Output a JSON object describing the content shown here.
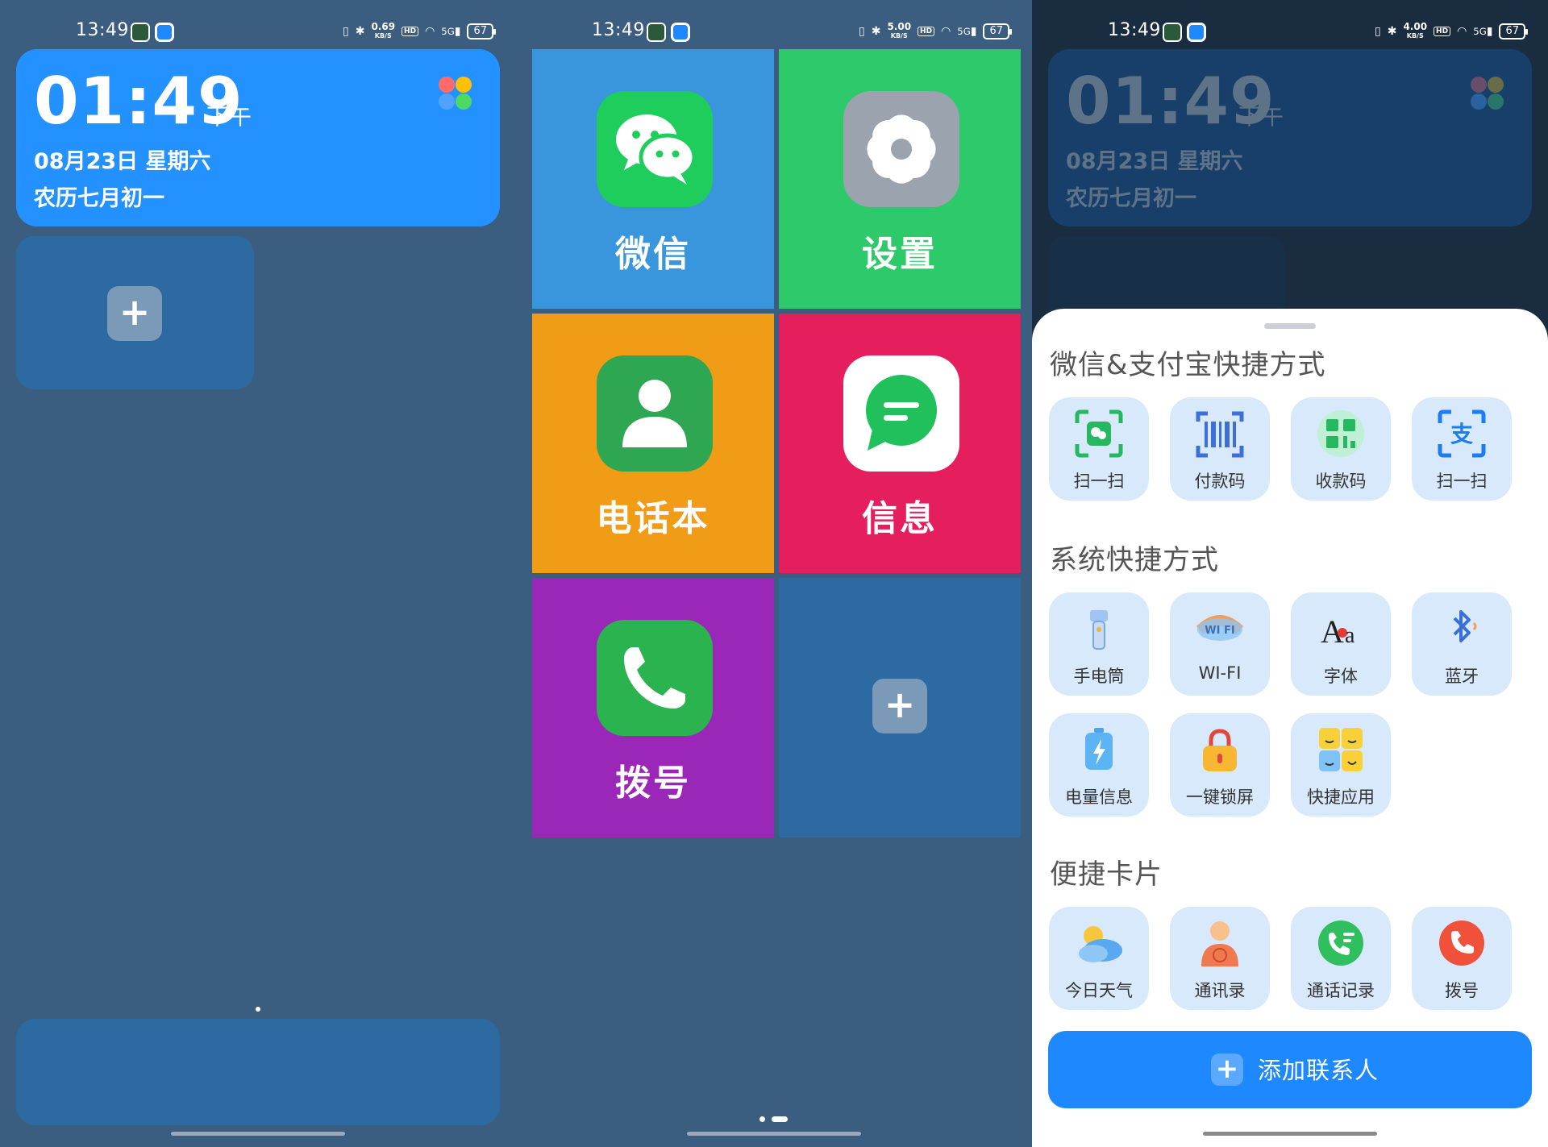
{
  "status_bar": {
    "time": "13:49",
    "battery": "67",
    "hd": "HD",
    "signal": "5G",
    "speed_unit": "KB/S",
    "speeds": [
      "0.69",
      "5.00",
      "4.00"
    ]
  },
  "clock_widget": {
    "time": "01:49",
    "ampm": "下午",
    "date": "08月23日  星期六",
    "lunar": "农历七月初一"
  },
  "tiles": [
    {
      "label": "微信",
      "icon": "wechat-icon",
      "color": "#3996dd"
    },
    {
      "label": "设置",
      "icon": "gear-icon",
      "color": "#2ec96b"
    },
    {
      "label": "电话本",
      "icon": "contact-icon",
      "color": "#f09c17"
    },
    {
      "label": "信息",
      "icon": "message-icon",
      "color": "#e51e5e"
    },
    {
      "label": "拨号",
      "icon": "phone-icon",
      "color": "#9a27b7"
    }
  ],
  "add_symbol": "+",
  "sheet": {
    "section1": {
      "title": "微信&支付宝快捷方式",
      "items": [
        {
          "label": "扫一扫",
          "icon": "wechat-scan-icon"
        },
        {
          "label": "付款码",
          "icon": "barcode-icon"
        },
        {
          "label": "收款码",
          "icon": "qr-code-icon"
        },
        {
          "label": "扫一扫",
          "icon": "alipay-scan-icon"
        }
      ]
    },
    "section2": {
      "title": "系统快捷方式",
      "items": [
        {
          "label": "手电筒",
          "icon": "flashlight-icon"
        },
        {
          "label": "WI-FI",
          "icon": "wifi-icon"
        },
        {
          "label": "字体",
          "icon": "font-icon"
        },
        {
          "label": "蓝牙",
          "icon": "bluetooth-icon"
        },
        {
          "label": "电量信息",
          "icon": "battery-icon"
        },
        {
          "label": "一键锁屏",
          "icon": "lock-icon"
        },
        {
          "label": "快捷应用",
          "icon": "quick-apps-icon"
        }
      ]
    },
    "section3": {
      "title": "便捷卡片",
      "items": [
        {
          "label": "今日天气",
          "icon": "weather-icon"
        },
        {
          "label": "通讯录",
          "icon": "address-book-icon"
        },
        {
          "label": "通话记录",
          "icon": "call-log-icon"
        },
        {
          "label": "拨号",
          "icon": "dial-icon"
        }
      ]
    },
    "cta": {
      "label": "添加联系人",
      "plus": "+"
    }
  },
  "font_icon_text": {
    "big": "A",
    "small": "a"
  },
  "wifi_icon_text": "WI FI",
  "alipay_char": "支",
  "colors": {
    "accent": "#1e88ff",
    "widget_bg": "#2e6aa2",
    "shortcut_bg": "#d7e9fb"
  }
}
